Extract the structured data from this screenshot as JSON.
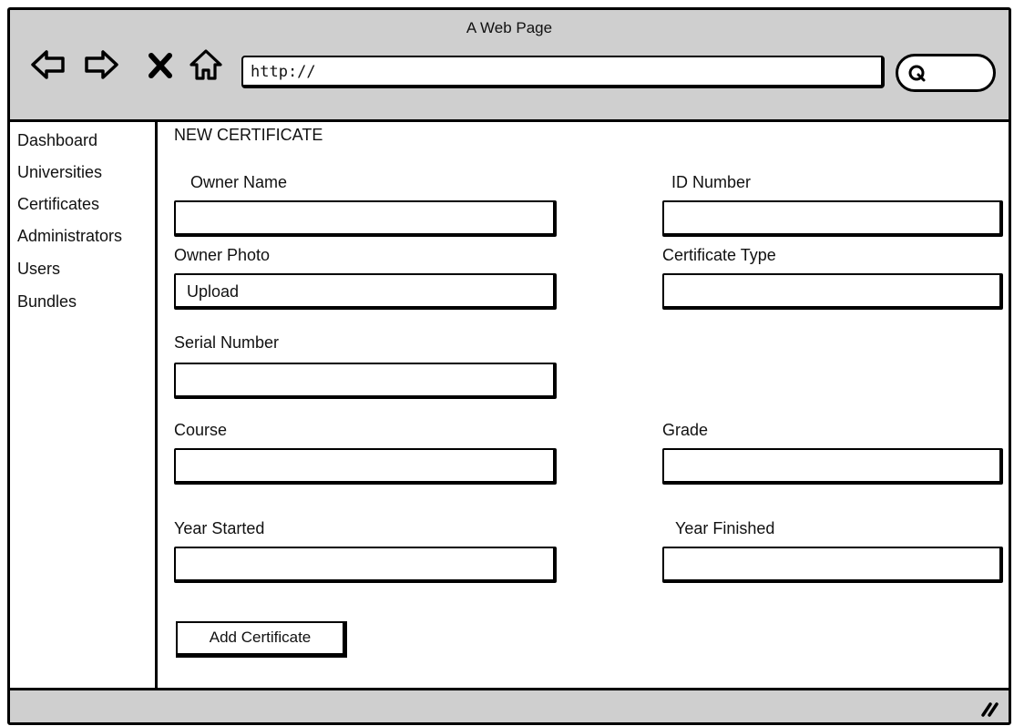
{
  "window": {
    "title": "A Web Page"
  },
  "toolbar": {
    "back_icon": "back-arrow-icon",
    "forward_icon": "forward-arrow-icon",
    "stop_icon": "close-icon",
    "home_icon": "home-icon",
    "address": "http://",
    "search_icon": "search-icon"
  },
  "sidebar": {
    "items": [
      {
        "label": "Dashboard"
      },
      {
        "label": "Universities"
      },
      {
        "label": "Certificates"
      },
      {
        "label": "Administrators"
      },
      {
        "label": "Users"
      },
      {
        "label": "Bundles"
      }
    ]
  },
  "form": {
    "heading": "NEW CERTIFICATE",
    "owner_name_label": "Owner Name",
    "owner_name_value": "",
    "id_number_label": "ID Number",
    "id_number_value": "",
    "owner_photo_label": "Owner Photo",
    "owner_photo_value": "Upload",
    "certificate_type_label": "Certificate Type",
    "certificate_type_value": "",
    "serial_number_label": "Serial Number",
    "serial_number_value": "",
    "course_label": "Course",
    "course_value": "",
    "grade_label": "Grade",
    "grade_value": "",
    "year_started_label": "Year Started",
    "year_started_value": "",
    "year_finished_label": "Year Finished",
    "year_finished_value": "",
    "submit_label": "Add Certificate"
  },
  "statusbar": {
    "resize_icon": "resize-grip-icon"
  }
}
